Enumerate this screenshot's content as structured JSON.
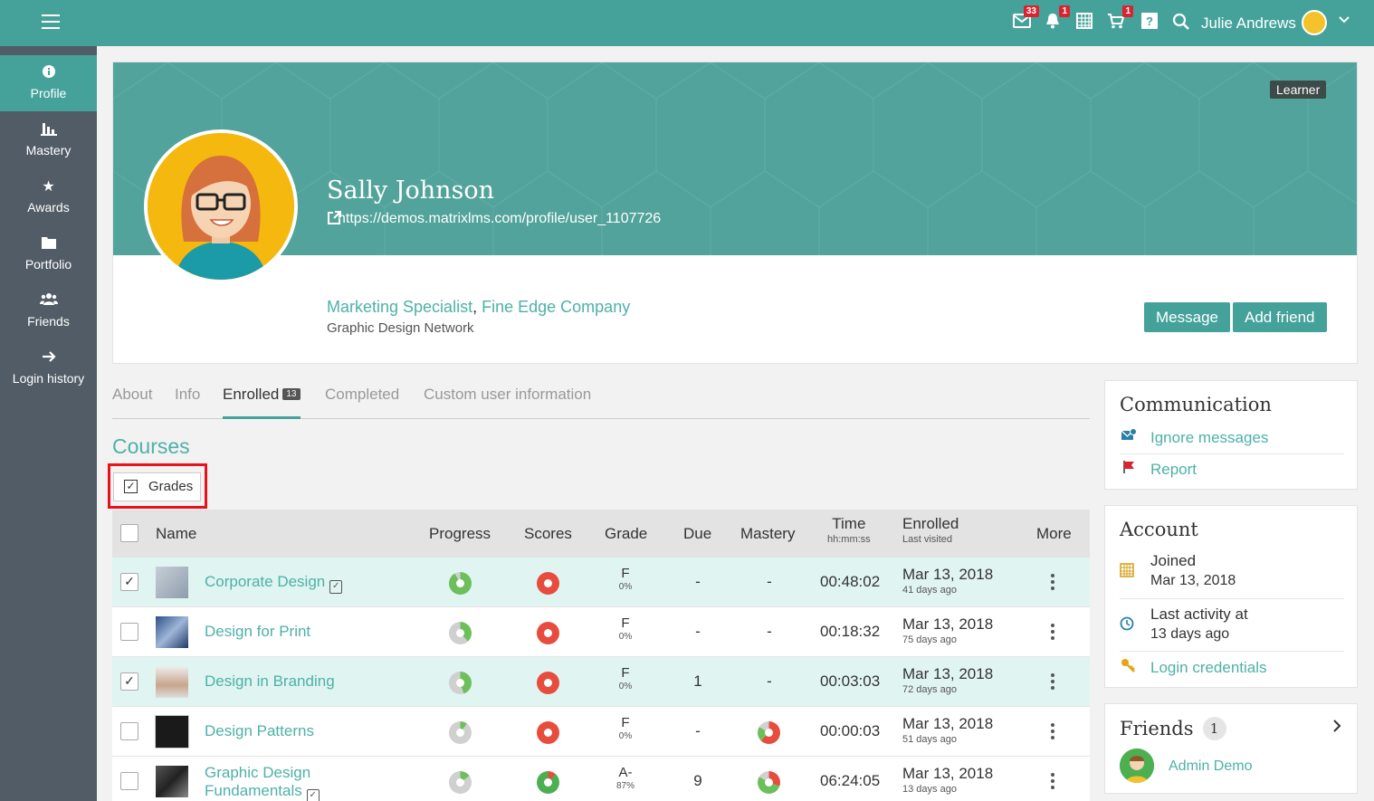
{
  "topbar": {
    "badges": {
      "messages": "33",
      "notifications": "1",
      "cart": "1"
    },
    "user_name": "Julie Andrews"
  },
  "sidebar": {
    "items": [
      {
        "label": "Profile",
        "icon": "info-icon"
      },
      {
        "label": "Mastery",
        "icon": "bar-chart-icon"
      },
      {
        "label": "Awards",
        "icon": "star-icon"
      },
      {
        "label": "Portfolio",
        "icon": "folder-icon"
      },
      {
        "label": "Friends",
        "icon": "users-icon"
      },
      {
        "label": "Login history",
        "icon": "arrow-right-icon"
      }
    ]
  },
  "profile": {
    "role_badge": "Learner",
    "name": "Sally Johnson",
    "url": "https://demos.matrixlms.com/profile/user_1107726",
    "job_title": "Marketing Specialist",
    "comma": ",",
    "company": "Fine Edge Company",
    "network": "Graphic Design Network",
    "message_button": "Message",
    "add_friend_button": "Add friend"
  },
  "tabs": [
    {
      "label": "About"
    },
    {
      "label": "Info"
    },
    {
      "label": "Enrolled",
      "count": "13"
    },
    {
      "label": "Completed"
    },
    {
      "label": "Custom user information"
    }
  ],
  "courses": {
    "heading": "Courses",
    "grades_toggle": "Grades",
    "columns": {
      "name": "Name",
      "progress": "Progress",
      "scores": "Scores",
      "grade": "Grade",
      "due": "Due",
      "mastery": "Mastery",
      "time": "Time",
      "time_sub": "hh:mm:ss",
      "enrolled": "Enrolled",
      "enrolled_sub": "Last visited",
      "more": "More"
    },
    "rows": [
      {
        "name": "Corporate Design",
        "checked": true,
        "progress": 0.08,
        "score_color": "#e74c3c",
        "grade": "F",
        "grade_pct": "0%",
        "due": "-",
        "mastery": "-",
        "time": "00:48:02",
        "enrolled": "Mar 13, 2018",
        "ago": "41 days ago"
      },
      {
        "name": "Design for Print",
        "checked": false,
        "progress": 0.62,
        "score_color": "#e74c3c",
        "grade": "F",
        "grade_pct": "0%",
        "due": "-",
        "mastery": "-",
        "time": "00:18:32",
        "enrolled": "Mar 13, 2018",
        "ago": "75 days ago"
      },
      {
        "name": "Design in Branding",
        "checked": true,
        "progress": 0.55,
        "score_color": "#e74c3c",
        "grade": "F",
        "grade_pct": "0%",
        "due": "1",
        "mastery": "-",
        "time": "00:03:03",
        "enrolled": "Mar 13, 2018",
        "ago": "72 days ago"
      },
      {
        "name": "Design Patterns",
        "checked": false,
        "progress": 0.9,
        "score_color": "#e74c3c",
        "grade": "F",
        "grade_pct": "0%",
        "due": "-",
        "mastery_pie": 0.62,
        "time": "00:00:03",
        "enrolled": "Mar 13, 2018",
        "ago": "51 days ago"
      },
      {
        "name_line1": "Graphic Design",
        "name_line2": "Fundamentals",
        "checked": false,
        "progress": 0.85,
        "score_color": "#4caf50",
        "grade": "A-",
        "grade_pct": "87%",
        "due": "9",
        "mastery_pie": 0.3,
        "time": "06:24:05",
        "enrolled": "Mar 13, 2018",
        "ago": "13 days ago"
      }
    ]
  },
  "communication": {
    "title": "Communication",
    "ignore": "Ignore messages",
    "report": "Report"
  },
  "account": {
    "title": "Account",
    "joined_label": "Joined",
    "joined_date": "Mar 13, 2018",
    "last_label": "Last activity at",
    "last_value": "13 days ago",
    "credentials": "Login credentials"
  },
  "friends": {
    "title": "Friends",
    "count": "1",
    "friend_name": "Admin Demo"
  },
  "colors": {
    "teal": "#45a29b",
    "link": "#4db1a8",
    "sidebar": "#525c66",
    "highlight": "#e8121b"
  }
}
